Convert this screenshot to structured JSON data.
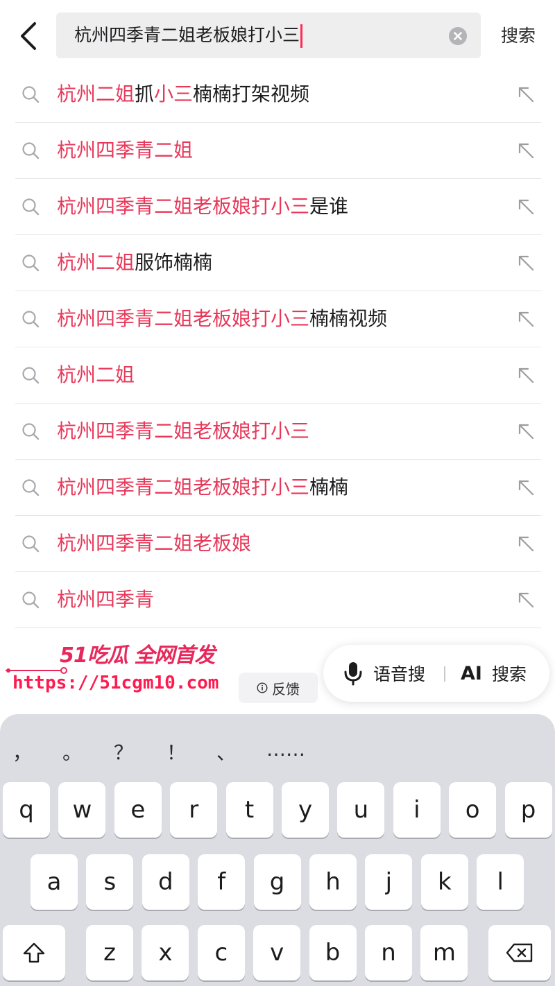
{
  "header": {
    "search_value": "杭州四季青二姐老板娘打小三",
    "search_button_label": "搜索"
  },
  "suggestions": [
    {
      "parts": [
        {
          "t": "杭州二姐",
          "h": true
        },
        {
          "t": "抓",
          "h": false
        },
        {
          "t": "小三",
          "h": true
        },
        {
          "t": "楠楠打架视频",
          "h": false
        }
      ]
    },
    {
      "parts": [
        {
          "t": "杭州四季青二姐",
          "h": true
        }
      ]
    },
    {
      "parts": [
        {
          "t": "杭州四季青二姐老板娘打小三",
          "h": true
        },
        {
          "t": "是谁",
          "h": false
        }
      ]
    },
    {
      "parts": [
        {
          "t": "杭州二姐",
          "h": true
        },
        {
          "t": "服饰楠楠",
          "h": false
        }
      ]
    },
    {
      "parts": [
        {
          "t": "杭州四季青二姐老板娘打小三",
          "h": true
        },
        {
          "t": "楠楠视频",
          "h": false
        }
      ]
    },
    {
      "parts": [
        {
          "t": "杭州二姐",
          "h": true
        }
      ]
    },
    {
      "parts": [
        {
          "t": "杭州四季青二姐老板娘打小三",
          "h": true
        }
      ]
    },
    {
      "parts": [
        {
          "t": "杭州四季青二姐老板娘打小三",
          "h": true
        },
        {
          "t": "楠楠",
          "h": false
        }
      ]
    },
    {
      "parts": [
        {
          "t": "杭州四季青二姐老板娘",
          "h": true
        }
      ]
    },
    {
      "parts": [
        {
          "t": "杭州四季青",
          "h": true
        }
      ]
    }
  ],
  "watermark": {
    "line1": "51吃瓜 全网首发",
    "line2": "https://51cgm10.com"
  },
  "feedback": {
    "label": "反馈",
    "icon": "info-icon"
  },
  "voice_ai": {
    "voice_label": "语音搜",
    "ai_prefix": "AI",
    "ai_label": "搜索"
  },
  "keyboard": {
    "punctuation": [
      "，",
      "。",
      "？",
      "！",
      "、",
      "……"
    ],
    "row1": [
      "q",
      "w",
      "e",
      "r",
      "t",
      "y",
      "u",
      "i",
      "o",
      "p"
    ],
    "row2": [
      "a",
      "s",
      "d",
      "f",
      "g",
      "h",
      "j",
      "k",
      "l"
    ],
    "row3": [
      "z",
      "x",
      "c",
      "v",
      "b",
      "n",
      "m"
    ],
    "shift_icon": "shift-icon",
    "delete_icon": "delete-icon"
  },
  "colors": {
    "highlight": "#e8385a",
    "caret": "#fe2c55",
    "keyboard_bg": "#dcdde2"
  }
}
